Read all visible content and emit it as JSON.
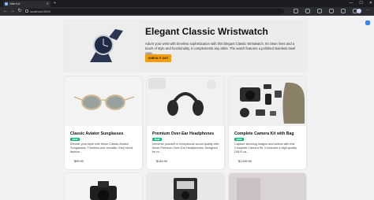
{
  "browser": {
    "tab_title": "Vite+Lit",
    "url": "localhost:3000"
  },
  "hero": {
    "title": "Elegant Classic Wristwatch",
    "description": "Adorn your wrist with timeless sophistication with this Elegant Classic Wristwatch. Its clean lines and a touch of style and functionality, it complements any attire. The watch features a polished stainless steel case, ...",
    "button_label": "CHECK IT OUT"
  },
  "products": [
    {
      "title": "Classic Aviator Sunglasses",
      "badge": "NEW",
      "description": "Elevate your style with these Classic Aviator Sunglasses. Timeless and versatile, they blend fashion...",
      "price": "$99.99"
    },
    {
      "title": "Premium Over-Ear Headphones",
      "badge": "NEW",
      "description": "Immerse yourself in exceptional sound quality with these Premium Over-Ear Headphones. Designed for m...",
      "price": "$149.99"
    },
    {
      "title": "Complete Camera Kit with Bag",
      "badge": "NEW",
      "description": "Capture stunning images and videos with this Complete Camera Kit. It includes a high-quality DSLR ca...",
      "price": "$1,099.99"
    }
  ],
  "colors": {
    "accent": "#f59e0b",
    "badge": "#10b981"
  }
}
